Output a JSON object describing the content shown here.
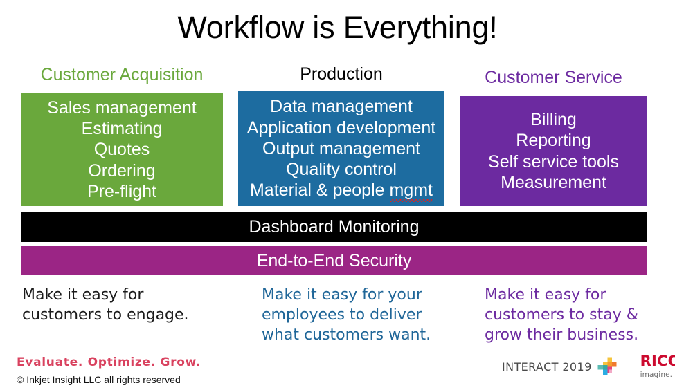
{
  "slide": {
    "title": "Workflow is Everything!",
    "background": "#ffffff"
  },
  "columns": [
    {
      "header": "Customer  Acquisition",
      "header_color": "#6aa83c",
      "box_color": "#6aa83c",
      "items": [
        "Sales management",
        "Estimating",
        "Quotes",
        "Ordering",
        "Pre-flight"
      ],
      "caption": {
        "lines": [
          "Make it easy for",
          "customers to engage."
        ],
        "color": "#1a1a1a"
      }
    },
    {
      "header": "Production",
      "header_color": "#000000",
      "box_color": "#1d6ca0",
      "items": [
        "Data management",
        "Application development",
        "Output management",
        "Quality control",
        "Material & people "
      ],
      "misspelled_word": "mgmt",
      "caption": {
        "lines": [
          "Make it easy for your",
          "employees to deliver",
          "what customers want."
        ],
        "color": "#1f6698"
      }
    },
    {
      "header": "Customer  Service",
      "header_color": "#6c2aa0",
      "box_color": "#6c2aa0",
      "items": [
        "Billing",
        "Reporting",
        "Self service tools",
        "Measurement"
      ],
      "caption": {
        "lines": [
          "Make it easy  for",
          "customers to stay &",
          "grow their business."
        ],
        "color": "#6c2aa0"
      }
    }
  ],
  "bars": [
    {
      "label": "Dashboard Monitoring",
      "color": "#000000",
      "text_color": "#ffffff"
    },
    {
      "label": "End-to-End Security",
      "color": "#9b2585",
      "text_color": "#ffffff"
    }
  ],
  "footer": {
    "tagline": "Evaluate. Optimize. Grow.",
    "tagline_color": "#d9425f",
    "copyright": "© Inkjet Insight LLC all rights reserved",
    "interact_label": "INTERACT 2019",
    "ricoh_name": "RICOH",
    "ricoh_tagline": "imagine. change.",
    "ricoh_color": "#cc0a2f"
  }
}
